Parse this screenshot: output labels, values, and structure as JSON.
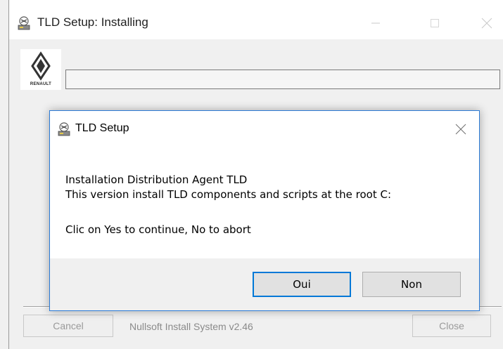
{
  "main_window": {
    "title": "TLD Setup: Installing",
    "brand": "RENAULT",
    "progress_percent": 0,
    "cancel_label": "Cancel",
    "branding_text": "Nullsoft Install System v2.46",
    "close_label": "Close"
  },
  "dialog": {
    "title": "TLD Setup",
    "message_line1": "Installation Distribution Agent TLD",
    "message_line2": "This version install TLD components and scripts at the root C:",
    "message_line3": "Clic on Yes to continue, No to abort",
    "yes_label": "Oui",
    "no_label": "Non"
  },
  "colors": {
    "dialog_border": "#2a7ad6",
    "default_button_border": "#0078d7",
    "progress_fill": "#06b025"
  },
  "icons": {
    "app_icon": "installer-app-icon",
    "brand_logo": "renault-logo"
  }
}
